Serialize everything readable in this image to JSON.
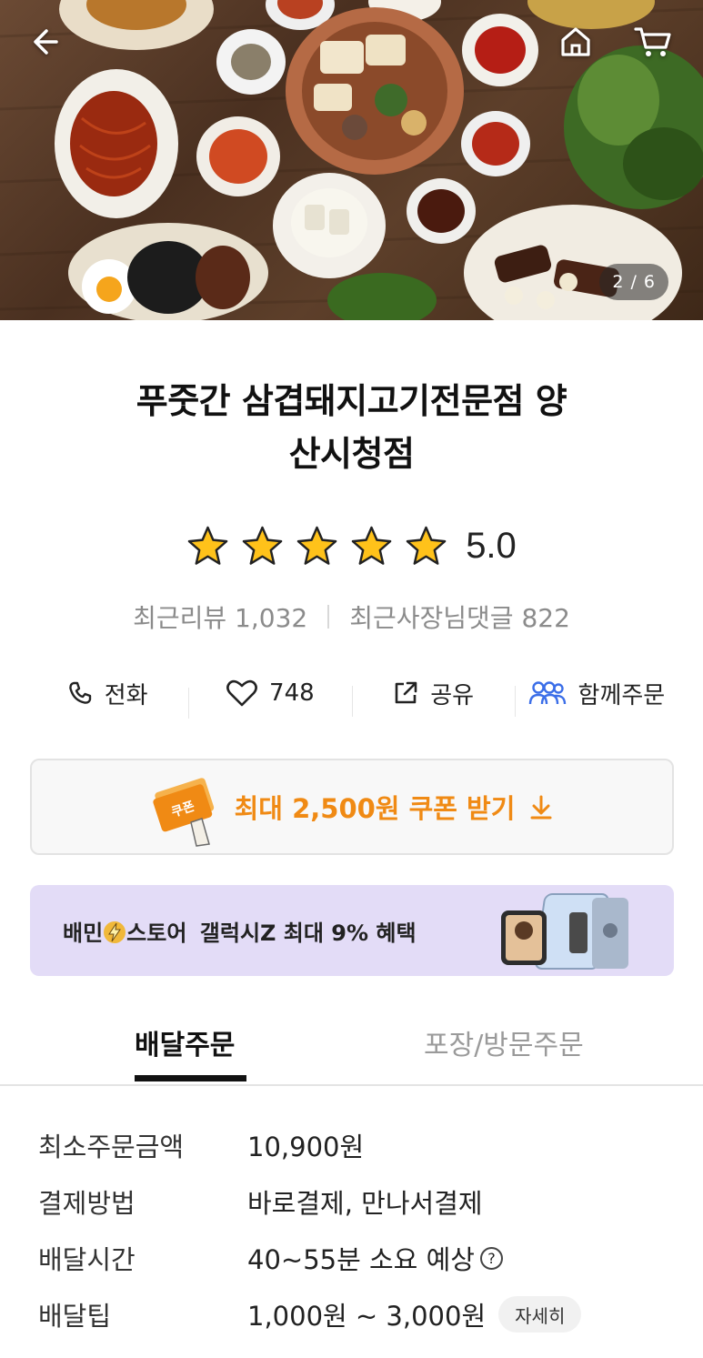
{
  "header": {
    "back_icon": "back-arrow-icon",
    "home_icon": "home-icon",
    "cart_icon": "cart-icon",
    "image_counter": "2 / 6"
  },
  "store": {
    "name_line1": "푸줏간 삼겹돼지고기전문점 양",
    "name_line2": "산시청점",
    "rating": "5.0",
    "stars": 5,
    "recent_reviews": "최근리뷰 1,032",
    "owner_replies": "최근사장님댓글 822"
  },
  "actions": {
    "call": "전화",
    "likes": "748",
    "share": "공유",
    "group_order": "함께주문"
  },
  "coupon": {
    "badge": "쿠폰",
    "text": "최대 2,500원 쿠폰 받기"
  },
  "banner": {
    "brand_a": "배민",
    "brand_b": "스토어",
    "text": "갤럭시Z 최대 9% 혜택"
  },
  "tabs": {
    "delivery": "배달주문",
    "pickup": "포장/방문주문"
  },
  "info": {
    "min_order_label": "최소주문금액",
    "min_order_value": "10,900원",
    "payment_label": "결제방법",
    "payment_value": "바로결제, 만나서결제",
    "delivery_time_label": "배달시간",
    "delivery_time_value": "40~55분 소요 예상",
    "delivery_tip_label": "배달팁",
    "delivery_tip_value": "1,000원 ~ 3,000원",
    "detail_button": "자세히"
  },
  "colors": {
    "accent_orange": "#f08a14",
    "star_yellow": "#ffc21a",
    "banner_bg": "#e3dcf7",
    "group_icon_blue": "#3b6ee8"
  }
}
